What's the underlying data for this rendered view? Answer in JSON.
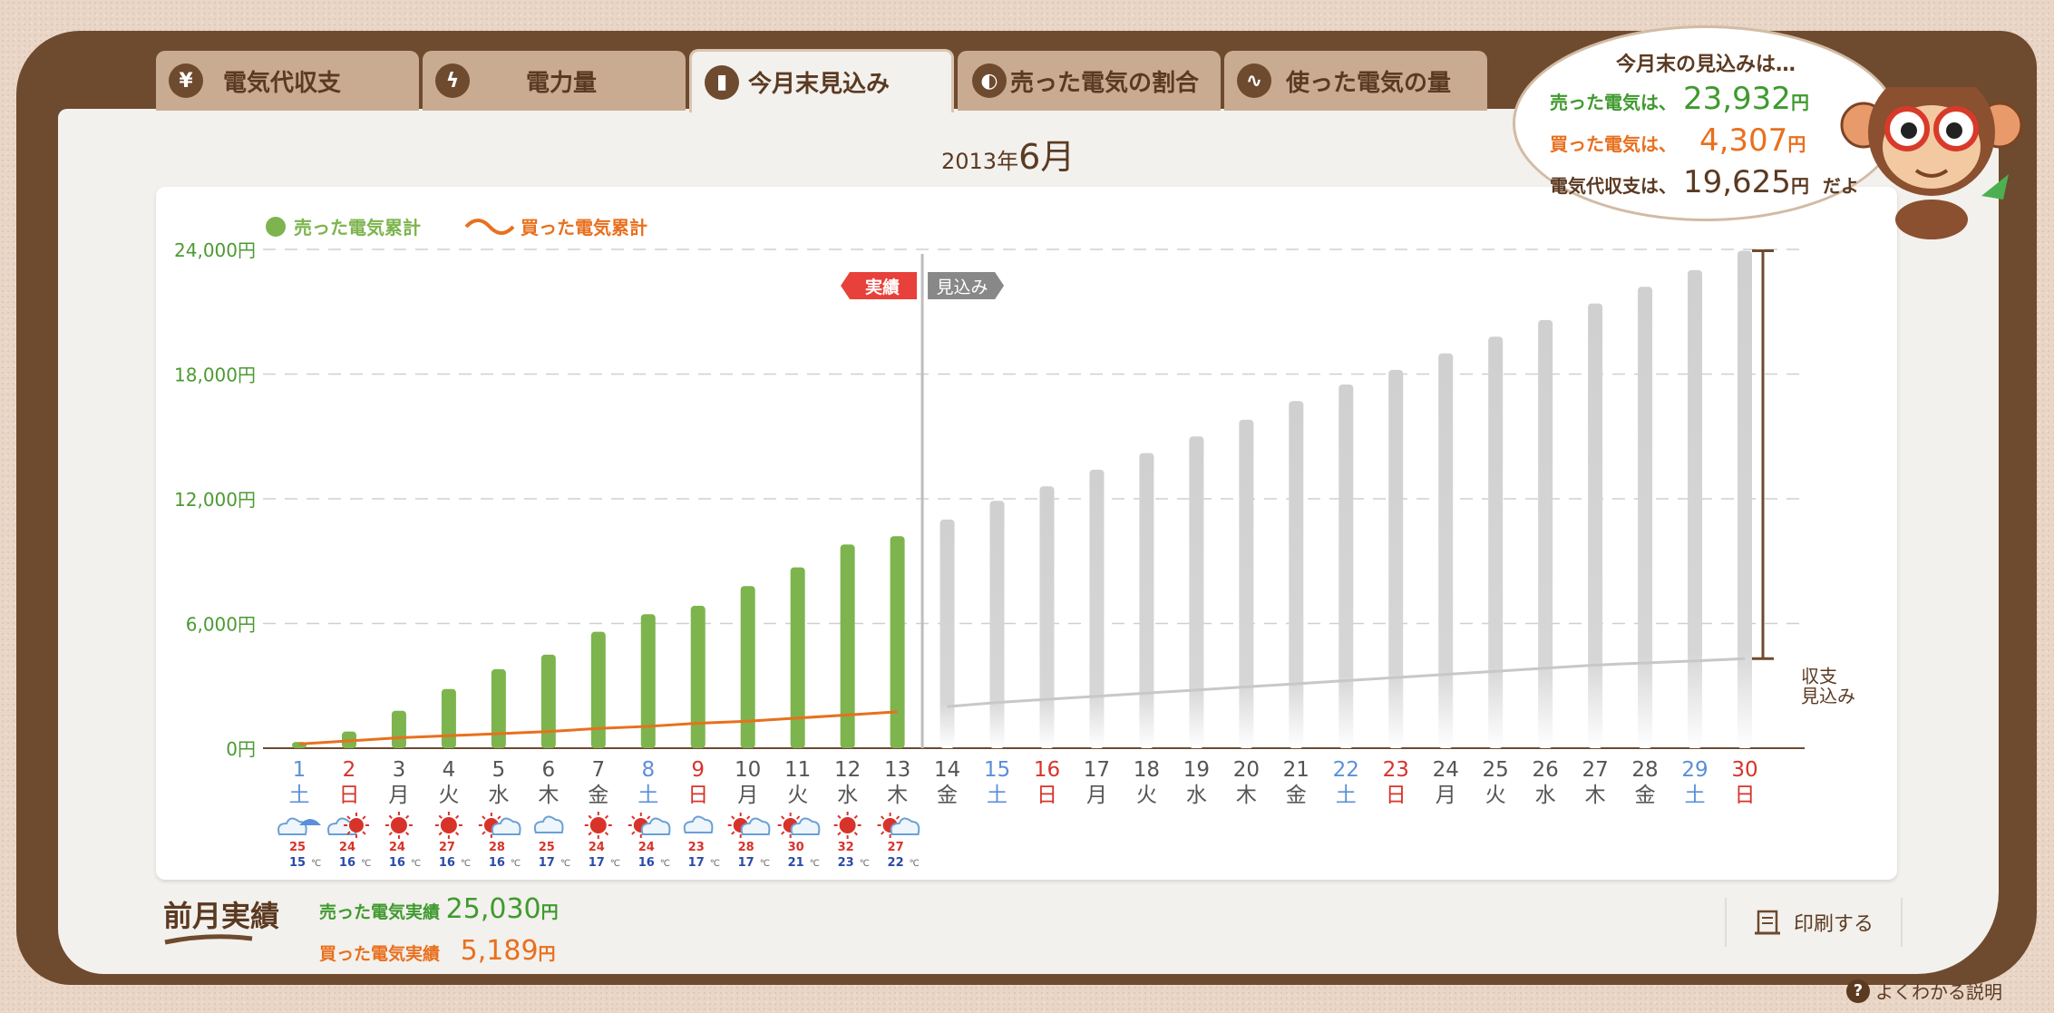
{
  "tabs": [
    {
      "label": "電気代収支",
      "icon": "yen-icon",
      "glyph": "¥"
    },
    {
      "label": "電力量",
      "icon": "lightning-icon",
      "glyph": "ϟ"
    },
    {
      "label": "今月末見込み",
      "icon": "bar-chart-icon",
      "glyph": "▮"
    },
    {
      "label": "売った電気の割合",
      "icon": "pie-chart-icon",
      "glyph": "◐"
    },
    {
      "label": "使った電気の量",
      "icon": "wave-icon",
      "glyph": "∿"
    }
  ],
  "month": {
    "year": "2013年",
    "month": "6月"
  },
  "bubble": {
    "title": "今月末の見込みは…",
    "sold_label": "売った電気は、",
    "sold_value": "23,932",
    "sold_unit": "円",
    "bought_label": "買った電気は、",
    "bought_value": "4,307",
    "bought_unit": "円",
    "balance_label": "電気代収支は、",
    "balance_value": "19,625",
    "balance_unit": "円",
    "suffix": "だよ"
  },
  "colors": {
    "sold": "#7db44e",
    "forecast": "#d2d2d2",
    "bought": "#e8701e",
    "sat": "#5b8fd9",
    "sun": "#d8332a",
    "brown": "#6e4a2f"
  },
  "chart_data": {
    "type": "bar",
    "title": "",
    "legend": [
      {
        "name": "売った電気累計",
        "mark": "dot",
        "color": "#7db44e"
      },
      {
        "name": "買った電気累計",
        "mark": "wave",
        "color": "#e8701e"
      }
    ],
    "legend_position": "top-left",
    "ylim": [
      0,
      24000
    ],
    "y_ticks": [
      "0円",
      "6,000円",
      "12,000円",
      "18,000円",
      "24,000円"
    ],
    "y_tick_values": [
      0,
      6000,
      12000,
      18000,
      24000
    ],
    "grid": true,
    "days": [
      1,
      2,
      3,
      4,
      5,
      6,
      7,
      8,
      9,
      10,
      11,
      12,
      13,
      14,
      15,
      16,
      17,
      18,
      19,
      20,
      21,
      22,
      23,
      24,
      25,
      26,
      27,
      28,
      29,
      30
    ],
    "weekdays": [
      "土",
      "日",
      "月",
      "火",
      "水",
      "木",
      "金",
      "土",
      "日",
      "月",
      "火",
      "水",
      "木",
      "金",
      "土",
      "日",
      "月",
      "火",
      "水",
      "木",
      "金",
      "土",
      "日",
      "月",
      "火",
      "水",
      "木",
      "金",
      "土",
      "日"
    ],
    "sold_cumulative": [
      300,
      800,
      1800,
      2850,
      3800,
      4500,
      5600,
      6450,
      6850,
      7800,
      8700,
      9800,
      10200,
      11000,
      11900,
      12600,
      13400,
      14200,
      15000,
      15800,
      16700,
      17500,
      18200,
      19000,
      19800,
      20600,
      21400,
      22200,
      23000,
      23932
    ],
    "bought_cumulative_actual": [
      200,
      350,
      500,
      600,
      700,
      800,
      950,
      1050,
      1200,
      1300,
      1450,
      1600,
      1750
    ],
    "bought_cumulative_forecast": [
      2000,
      2200,
      2350,
      2500,
      2650,
      2800,
      2950,
      3100,
      3250,
      3400,
      3550,
      3700,
      3850,
      4000,
      4100,
      4200,
      4307
    ],
    "actual_days": 13,
    "marker_actual": "実績",
    "marker_forecast": "見込み",
    "balance_label": [
      "収支",
      "見込み"
    ],
    "weather": [
      {
        "icon": "cloud-umbrella-icon",
        "high": "25",
        "low": "15"
      },
      {
        "icon": "cloud-sun-icon",
        "high": "24",
        "low": "16"
      },
      {
        "icon": "sun-icon",
        "high": "24",
        "low": "16"
      },
      {
        "icon": "sun-icon",
        "high": "27",
        "low": "16"
      },
      {
        "icon": "sun-cloud-icon",
        "high": "28",
        "low": "16"
      },
      {
        "icon": "cloud-icon",
        "high": "25",
        "low": "17"
      },
      {
        "icon": "sun-icon",
        "high": "24",
        "low": "17"
      },
      {
        "icon": "sun-cloud-icon",
        "high": "24",
        "low": "16"
      },
      {
        "icon": "cloud-icon",
        "high": "23",
        "low": "17"
      },
      {
        "icon": "sun-cloud-icon",
        "high": "28",
        "low": "17"
      },
      {
        "icon": "sun-cloud-icon",
        "high": "30",
        "low": "21"
      },
      {
        "icon": "sun-icon",
        "high": "32",
        "low": "23"
      },
      {
        "icon": "sun-cloud-icon",
        "high": "27",
        "low": "22"
      }
    ],
    "temp_unit": "℃"
  },
  "prev_month": {
    "title": "前月実績",
    "sold_label": "売った電気実績",
    "sold_value": "25,030",
    "sold_unit": "円",
    "bought_label": "買った電気実績",
    "bought_value": "5,189",
    "bought_unit": "円"
  },
  "print_label": "印刷する",
  "help_label": "よくわかる説明"
}
